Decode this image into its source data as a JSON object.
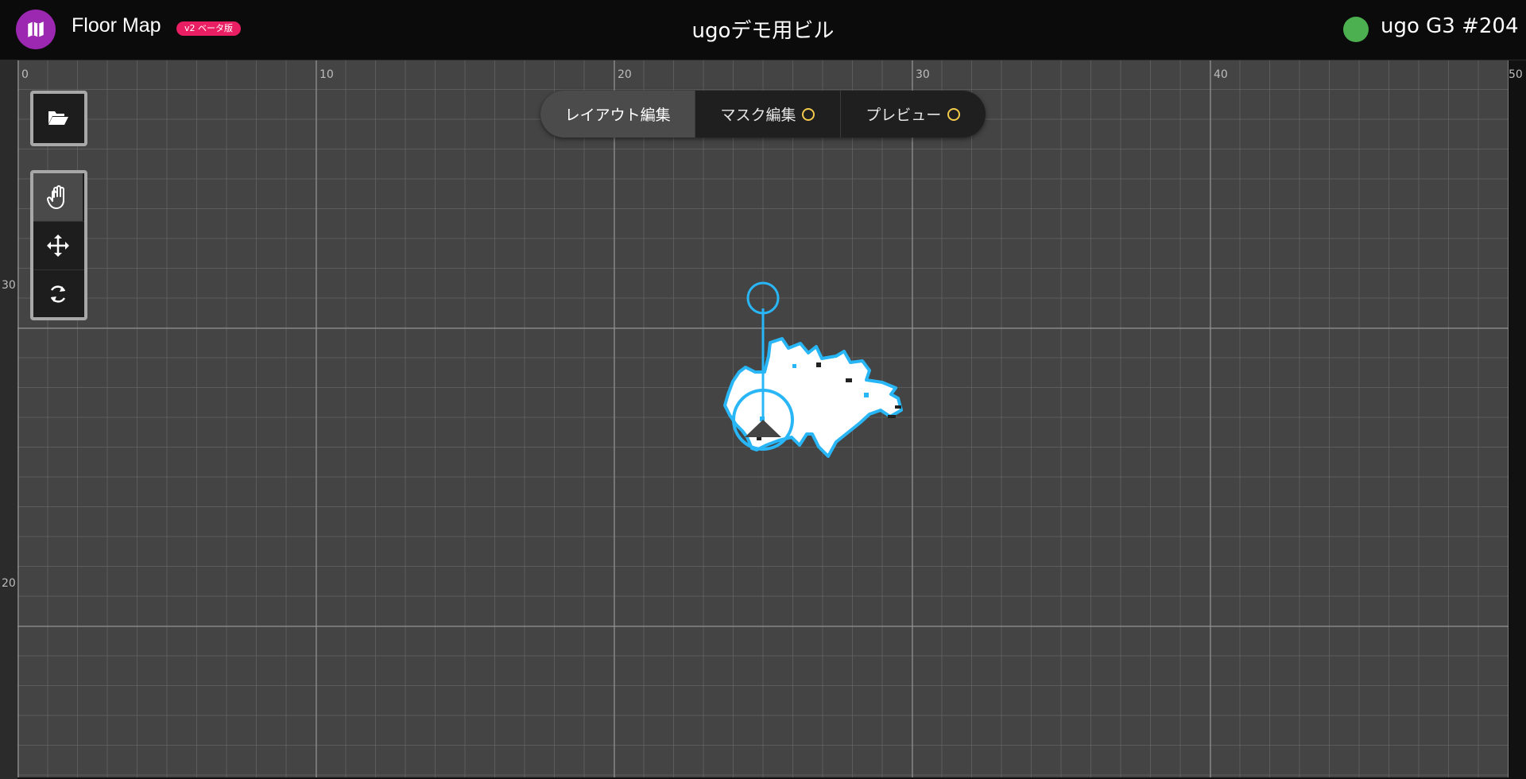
{
  "header": {
    "app_title": "Floor Map",
    "beta_badge": "v2 ベータ版",
    "building_title": "ugoデモ用ビル",
    "robot_name": "ugo G3 #204",
    "robot_status_color": "#4caf50",
    "logo_icon": "map-icon"
  },
  "canvas": {
    "x_axis_labels": [
      "0",
      "10",
      "20",
      "30",
      "40",
      "50"
    ],
    "y_axis_labels": [
      "30",
      "20"
    ]
  },
  "mode_tabs": [
    {
      "label": "レイアウト編集",
      "active": true
    },
    {
      "label": "マスク編集",
      "pending": true
    },
    {
      "label": "プレビュー",
      "pending": true
    }
  ],
  "tools": {
    "file_icon": "folder-open-icon",
    "pan_icon": "hand-icon",
    "move_icon": "move-arrows-icon",
    "rotate_icon": "rotate-icon",
    "active_tool": "pan"
  },
  "colors": {
    "accent": "#29b6f6",
    "pending": "#f2c94c",
    "badge": "#e91e63",
    "logo": "#9c27b0"
  }
}
